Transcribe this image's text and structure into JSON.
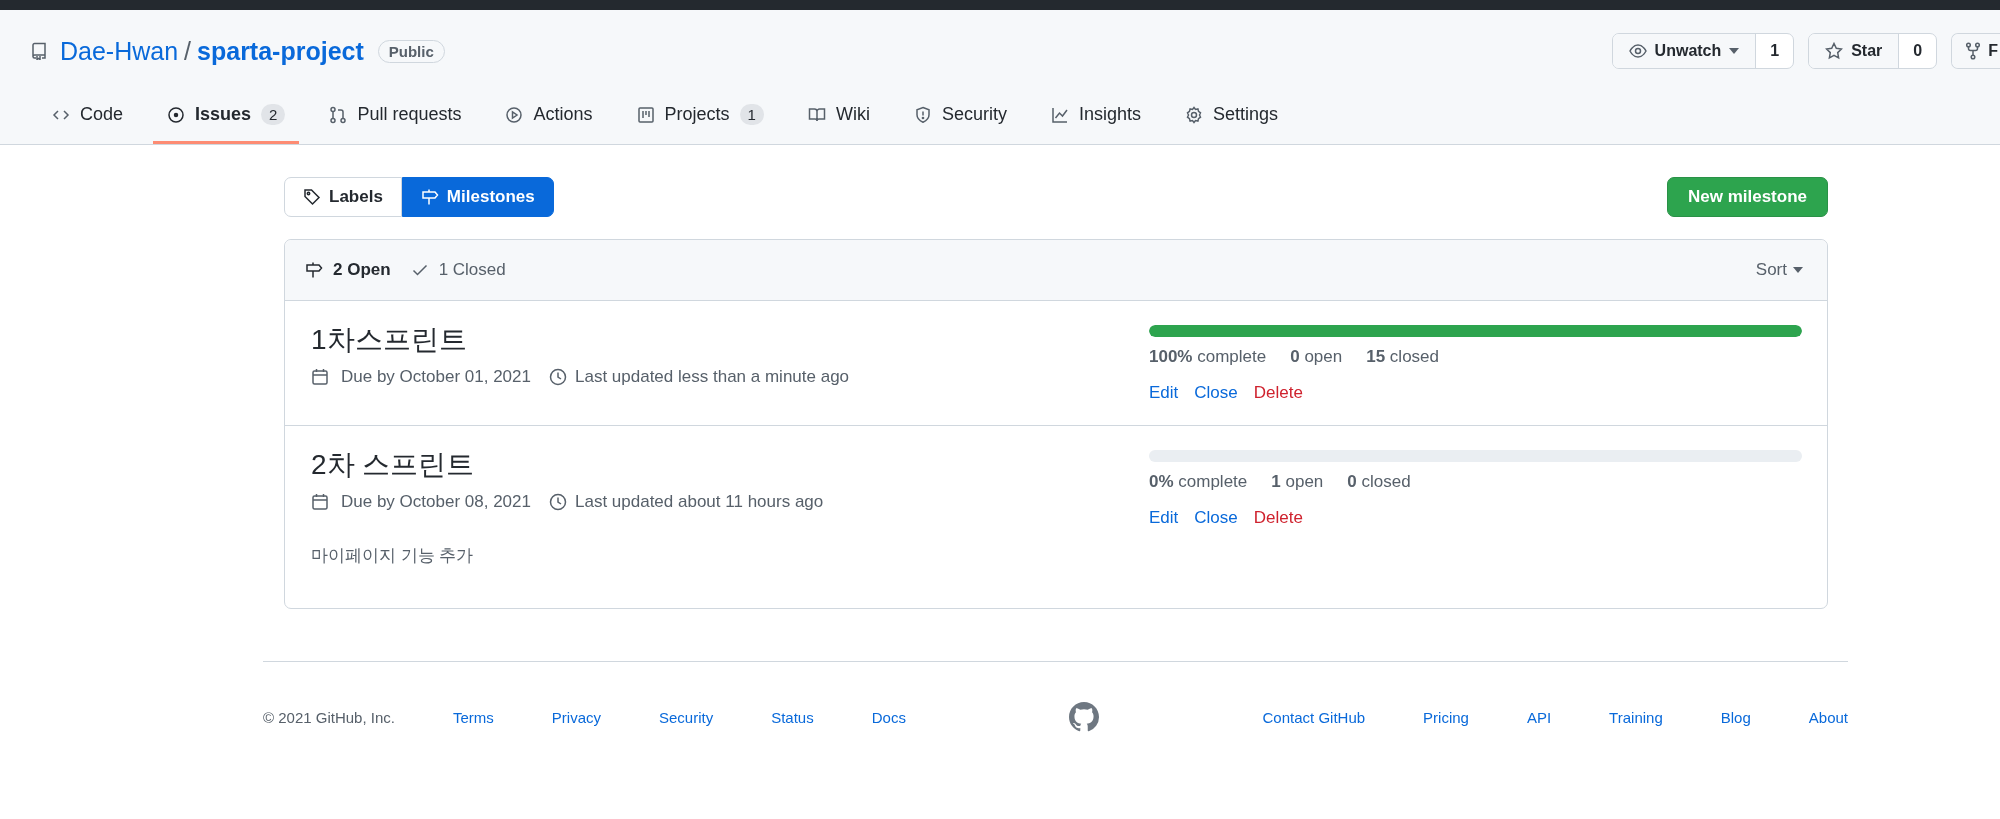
{
  "repo": {
    "owner": "Dae-Hwan",
    "separator": "/",
    "name": "sparta-project",
    "visibility": "Public"
  },
  "repo_actions": [
    {
      "kind": "watch",
      "label": "Unwatch",
      "count": "1"
    },
    {
      "kind": "star",
      "label": "Star",
      "count": "0"
    },
    {
      "kind": "fork",
      "label": "F"
    }
  ],
  "tabs": [
    {
      "kind": "code",
      "label": "Code",
      "selected": false
    },
    {
      "kind": "issue",
      "label": "Issues",
      "count": "2",
      "selected": true
    },
    {
      "kind": "pull",
      "label": "Pull requests",
      "selected": false
    },
    {
      "kind": "play",
      "label": "Actions",
      "selected": false
    },
    {
      "kind": "project",
      "label": "Projects",
      "count": "1",
      "selected": false
    },
    {
      "kind": "book",
      "label": "Wiki",
      "selected": false
    },
    {
      "kind": "shield",
      "label": "Security",
      "selected": false
    },
    {
      "kind": "graph",
      "label": "Insights",
      "selected": false
    },
    {
      "kind": "gear",
      "label": "Settings",
      "selected": false
    }
  ],
  "subnav": [
    {
      "kind": "tag",
      "label": "Labels",
      "selected": false
    },
    {
      "kind": "milestone",
      "label": "Milestones",
      "selected": true
    }
  ],
  "new_button": "New milestone",
  "filters": [
    {
      "kind": "open",
      "label": "2 Open",
      "selected": true
    },
    {
      "kind": "closed",
      "label": "1 Closed",
      "selected": false
    }
  ],
  "sort": "Sort",
  "milestones": [
    {
      "title": "1차스프린트",
      "due": "Due by October 01, 2021",
      "updated": "Last updated less than a minute ago",
      "level": 1,
      "percent": "100%",
      "percent_label": "complete",
      "open_count": "0",
      "open_label": "open",
      "closed_count": "15",
      "closed_label": "closed",
      "actions": [
        {
          "kind": "edit",
          "label": "Edit"
        },
        {
          "kind": "close",
          "label": "Close"
        },
        {
          "kind": "delete",
          "label": "Delete"
        }
      ]
    },
    {
      "title": "2차 스프린트",
      "due": "Due by October 08, 2021",
      "updated": "Last updated about 11 hours ago",
      "description": "마이페이지 기능 추가",
      "level": 0,
      "percent": "0%",
      "percent_label": "complete",
      "open_count": "1",
      "open_label": "open",
      "closed_count": "0",
      "closed_label": "closed",
      "actions": [
        {
          "kind": "edit",
          "label": "Edit"
        },
        {
          "kind": "close",
          "label": "Close"
        },
        {
          "kind": "delete",
          "label": "Delete"
        }
      ]
    }
  ],
  "footer": {
    "copyright": "© 2021 GitHub, Inc.",
    "left_links": [
      "Terms",
      "Privacy",
      "Security",
      "Status",
      "Docs"
    ],
    "right_links": [
      "Contact GitHub",
      "Pricing",
      "API",
      "Training",
      "Blog",
      "About"
    ]
  }
}
